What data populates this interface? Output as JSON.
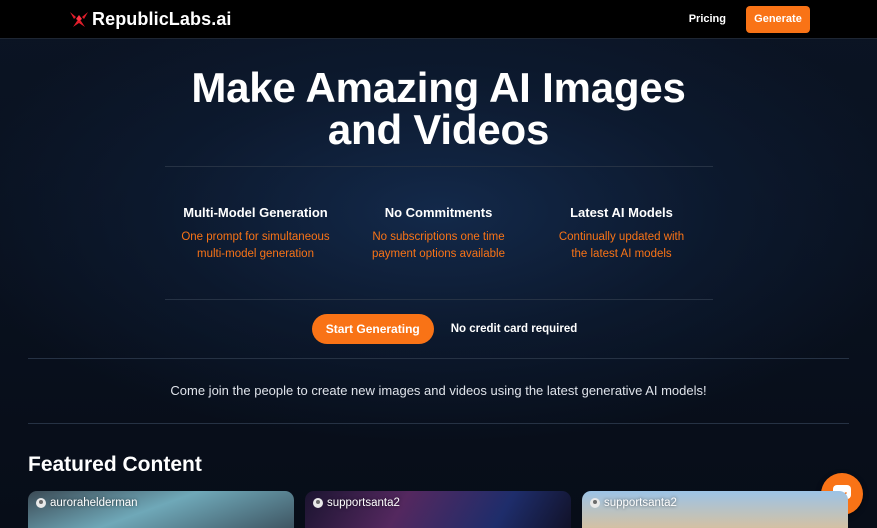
{
  "header": {
    "brand": "RepublicLabs.ai",
    "pricing_label": "Pricing",
    "generate_label": "Generate"
  },
  "hero": {
    "title_line1": "Make Amazing AI Images",
    "title_line2": "and Videos"
  },
  "features": [
    {
      "title": "Multi-Model Generation",
      "desc_line1": "One prompt for simultaneous",
      "desc_line2": "multi-model generation"
    },
    {
      "title": "No Commitments",
      "desc_line1": "No subscriptions one time",
      "desc_line2": "payment options available"
    },
    {
      "title": "Latest AI Models",
      "desc_line1": "Continually updated with",
      "desc_line2": "the latest AI models"
    }
  ],
  "cta": {
    "button_label": "Start Generating",
    "note": "No credit card required"
  },
  "join_text": "Come join the people to create new images and videos using the latest generative AI models!",
  "featured": {
    "title": "Featured Content",
    "cards": [
      {
        "user": "aurorahelderman"
      },
      {
        "user": "supportsanta2"
      },
      {
        "user": "supportsanta2"
      }
    ]
  },
  "colors": {
    "accent": "#f97316",
    "background": "#0a1220",
    "header_bg": "#000000"
  },
  "icons": {
    "brand": "republiclabs-logo-icon",
    "user": "user-avatar-icon",
    "chat": "chat-bubble-icon"
  }
}
